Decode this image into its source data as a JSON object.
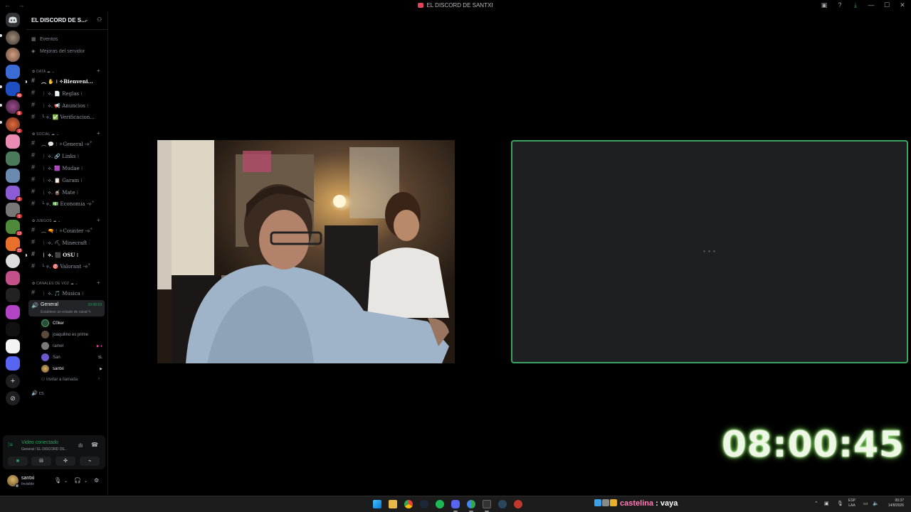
{
  "titlebar": {
    "nav": "← →",
    "title": "EL DISCORD DE SANTXI",
    "controls": [
      "▣",
      "?",
      "⤓",
      "—",
      "☐",
      "✕"
    ]
  },
  "server_rail": {
    "badges": [
      "49",
      "9",
      "1",
      "2",
      "1",
      "13",
      "23"
    ]
  },
  "sidebar": {
    "server_name": "EL DISCORD DE S...",
    "menu": [
      {
        "icon": "calendar-icon",
        "glyph": "▦",
        "label": "Eventos"
      },
      {
        "icon": "boost-icon",
        "glyph": "◈",
        "label": "Mejoras del servidor"
      }
    ],
    "categories": [
      {
        "label": "✿ DATA ☁ ⌄"
      },
      {
        "label": "✿ SOCIAL ☁ ⌄"
      },
      {
        "label": "✿ JUEGOS ☁ ⌄"
      },
      {
        "label": "✿ CANALES DE VOZ ☁ ⌄"
      }
    ],
    "channels": [
      {
        "label": "︵ ✋ ⁝ ✧Bienveni...",
        "bold": true
      },
      {
        "label": "︱ ⟡. 📄 Reglas ⁝",
        "bold": false
      },
      {
        "label": "︱ ⟡. 📢 Anuncios ⁝",
        "bold": false
      },
      {
        "label": "╰ ⟡. ✅ Verificacion...",
        "bold": false
      },
      {
        "label": "︵ 💬 ⁝ ✧General -⟡˚",
        "bold": false
      },
      {
        "label": "︱ ⟡. 🔗 Links ⁝",
        "bold": false
      },
      {
        "label": "︱ ⟡. 🟪 Mudae ⁝",
        "bold": false
      },
      {
        "label": "︱ ⟡. 📋 Garam ⁝",
        "bold": false
      },
      {
        "label": "︱ ⟡. 🧉 Mate ⁝",
        "bold": false
      },
      {
        "label": "╰ ⟡. 💵 Economia -⟡˚",
        "bold": false
      },
      {
        "label": "︵ 🔫 ⁝ ✧Counter -⟡˚",
        "bold": false
      },
      {
        "label": "︱ ⟡. ⛏ Minecraft ⁝",
        "bold": false
      },
      {
        "label": "︱ ⟡. ⬛ OSU ⁝",
        "bold": true
      },
      {
        "label": "╰ ⟡. 🎯 Valorant -⟡˚",
        "bold": false
      },
      {
        "label": "︱ ⟡. 🎵 Musica ⁝",
        "bold": false
      }
    ],
    "voice_channel": {
      "name": "General",
      "timer": "10:05:53",
      "status": "Establece un estado de canal ✎"
    },
    "voice_users": [
      {
        "name": "C0ker",
        "bright": true,
        "icon": ""
      },
      {
        "name": "joaquilino es prime",
        "bright": false,
        "icon": ""
      },
      {
        "name": "ramel",
        "bright": false,
        "icon": "▶ ●"
      },
      {
        "name": "San",
        "bright": false,
        "icon": "SL"
      },
      {
        "name": "santxi",
        "bright": true,
        "icon": "▶"
      }
    ],
    "invite": {
      "label": "Invitar a llamada",
      "arrow": "›"
    },
    "extra_voice": "cs"
  },
  "voice_panel": {
    "title": "Video conectado",
    "subtitle": "General / EL DISCORD DE...",
    "buttons": [
      "■",
      "⊟",
      "✣",
      "⌁"
    ]
  },
  "user_panel": {
    "name": "santxi",
    "status": "Invisible"
  },
  "stream": {
    "loading": "• • •"
  },
  "overlay_clock": "08:00:45",
  "taskbar": {
    "chat": {
      "nick": "castelina",
      "sep": " : ",
      "message": "vaya"
    },
    "lang_top": "ESP",
    "lang_bottom": "LAA",
    "time": "00:37",
    "date": "14/8/2026"
  },
  "colors": {
    "accent_green": "#23a55a",
    "stream_border": "#3ba55d",
    "clock_glow": "#b8ff9a",
    "chat_nick": "#ff7eb6"
  }
}
